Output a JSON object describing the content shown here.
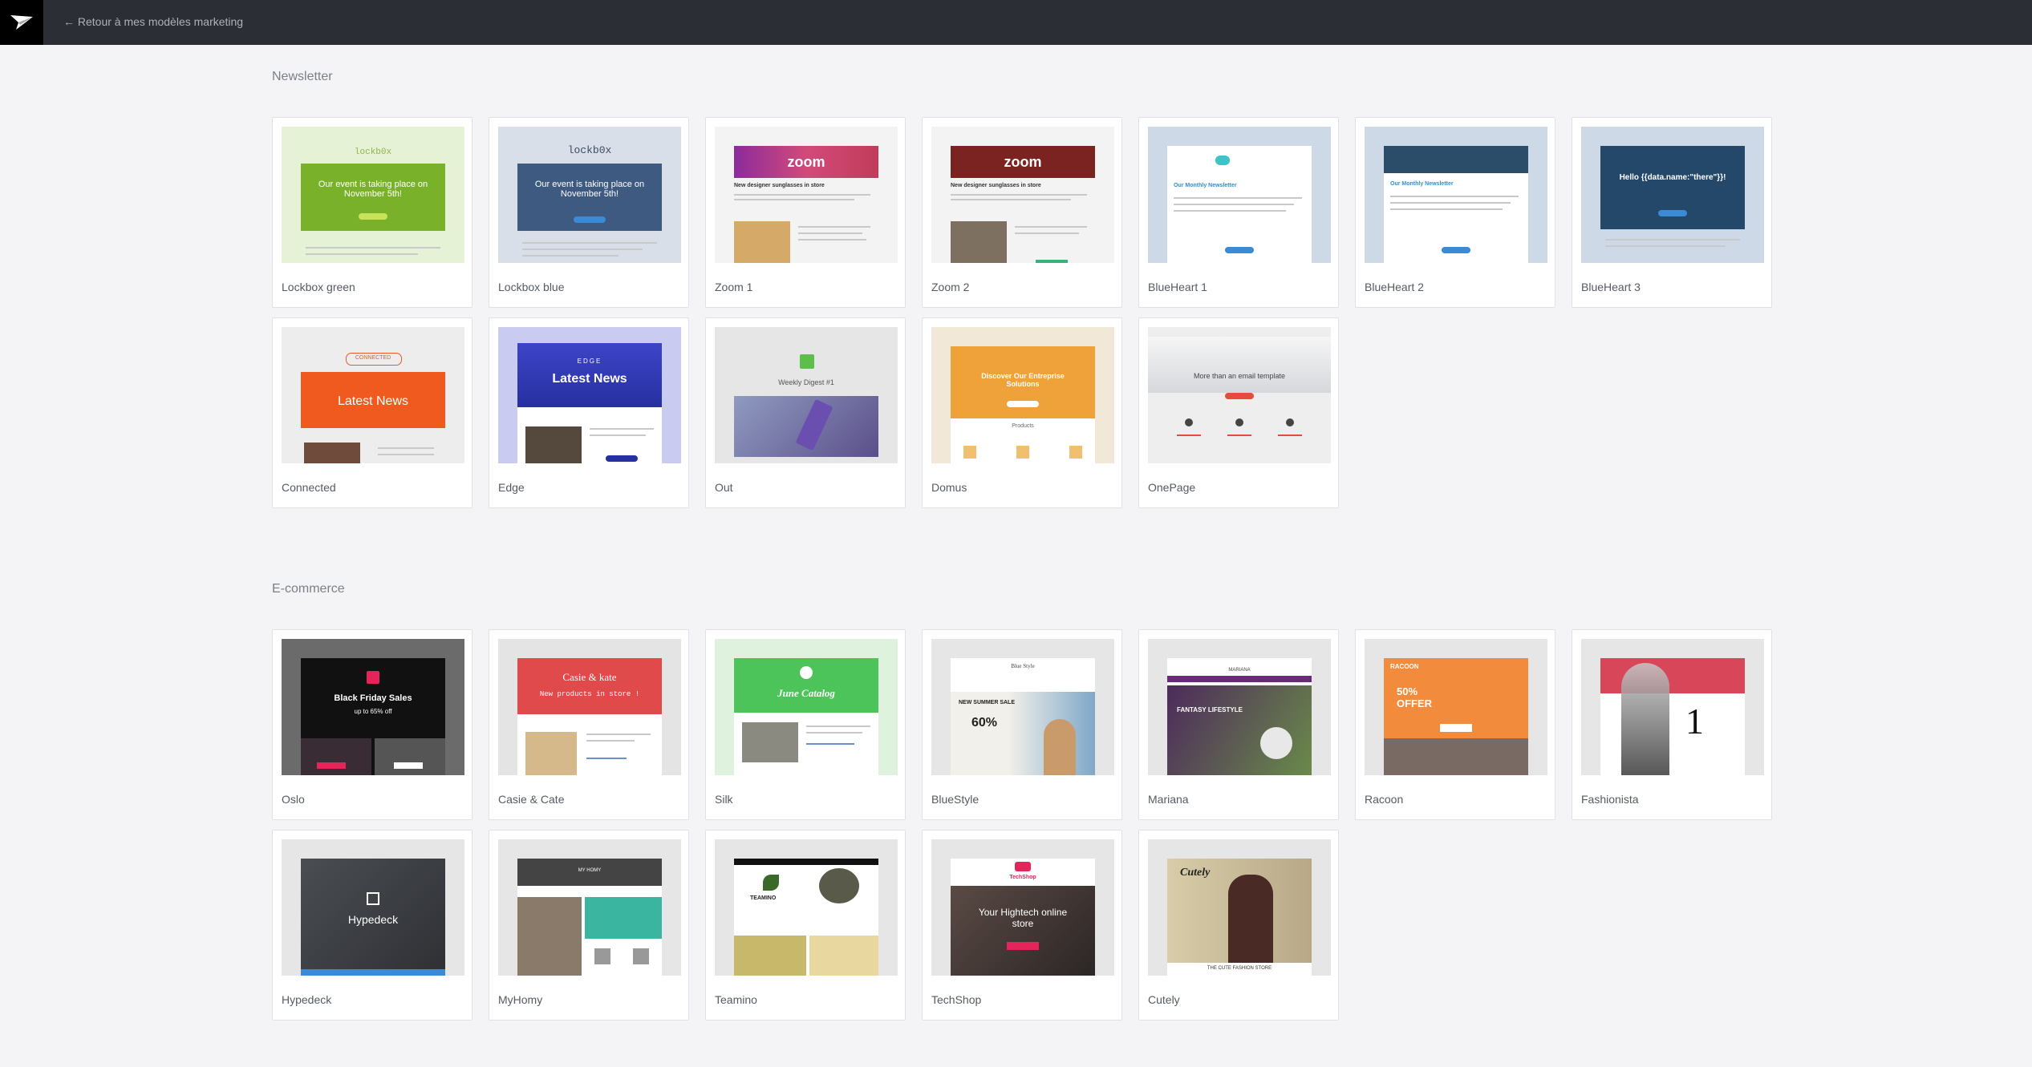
{
  "header": {
    "back_label": "← Retour à mes modèles marketing",
    "logo_icon": "paper-plane-icon"
  },
  "sections": [
    {
      "title": "Newsletter",
      "templates": [
        {
          "name": "Lockbox green",
          "thumb_text": "Our event is taking place on November 5th!",
          "brand": "lockb0x"
        },
        {
          "name": "Lockbox blue",
          "thumb_text": "Our event is taking place on November 5th!",
          "brand": "lockb0x"
        },
        {
          "name": "Zoom 1",
          "brand": "zoom",
          "thumb_text": "New designer sunglasses in store"
        },
        {
          "name": "Zoom 2",
          "brand": "zoom",
          "thumb_text": "New designer sunglasses in store"
        },
        {
          "name": "BlueHeart 1",
          "thumb_text": "Our Monthly Newsletter"
        },
        {
          "name": "BlueHeart 2",
          "thumb_text": "Our Monthly Newsletter"
        },
        {
          "name": "BlueHeart 3",
          "thumb_text": "Hello {{data.name:\"there\"}}!"
        },
        {
          "name": "Connected",
          "brand": "CONNECTED",
          "thumb_text": "Latest News"
        },
        {
          "name": "Edge",
          "brand": "EDGE",
          "thumb_text": "Latest News"
        },
        {
          "name": "Out",
          "thumb_text": "Weekly Digest #1"
        },
        {
          "name": "Domus",
          "thumb_text": "Discover Our Entreprise Solutions",
          "sub_text": "Products"
        },
        {
          "name": "OnePage",
          "thumb_text": "More than an email template"
        }
      ]
    },
    {
      "title": "E-commerce",
      "templates": [
        {
          "name": "Oslo",
          "thumb_text": "Black Friday Sales",
          "sub_text": "up to 65% off"
        },
        {
          "name": "Casie & Cate",
          "brand": "Casie & kate",
          "thumb_text": "New products in store !"
        },
        {
          "name": "Silk",
          "thumb_text": "June Catalog"
        },
        {
          "name": "BlueStyle",
          "brand": "Blue Style",
          "thumb_text": "NEW SUMMER SALE",
          "sub_text": "60%"
        },
        {
          "name": "Mariana",
          "brand": "MARIANA",
          "thumb_text": "FANTASY LIFESTYLE"
        },
        {
          "name": "Racoon",
          "brand": "RACOON",
          "thumb_text": "50% OFFER"
        },
        {
          "name": "Fashionista",
          "thumb_text": "1"
        },
        {
          "name": "Hypedeck",
          "thumb_text": "Hypedeck"
        },
        {
          "name": "MyHomy",
          "brand": "MY HOMY"
        },
        {
          "name": "Teamino",
          "brand": "TEAMINO"
        },
        {
          "name": "TechShop",
          "brand": "TechShop",
          "thumb_text": "Your Hightech online store"
        },
        {
          "name": "Cutely",
          "brand": "Cutely",
          "thumb_text": "THE CUTE FASHION STORE"
        }
      ]
    }
  ],
  "colors": {
    "topbar": "#2c2e35",
    "page_bg": "#f4f4f6",
    "card_border": "#e0e1e5"
  }
}
